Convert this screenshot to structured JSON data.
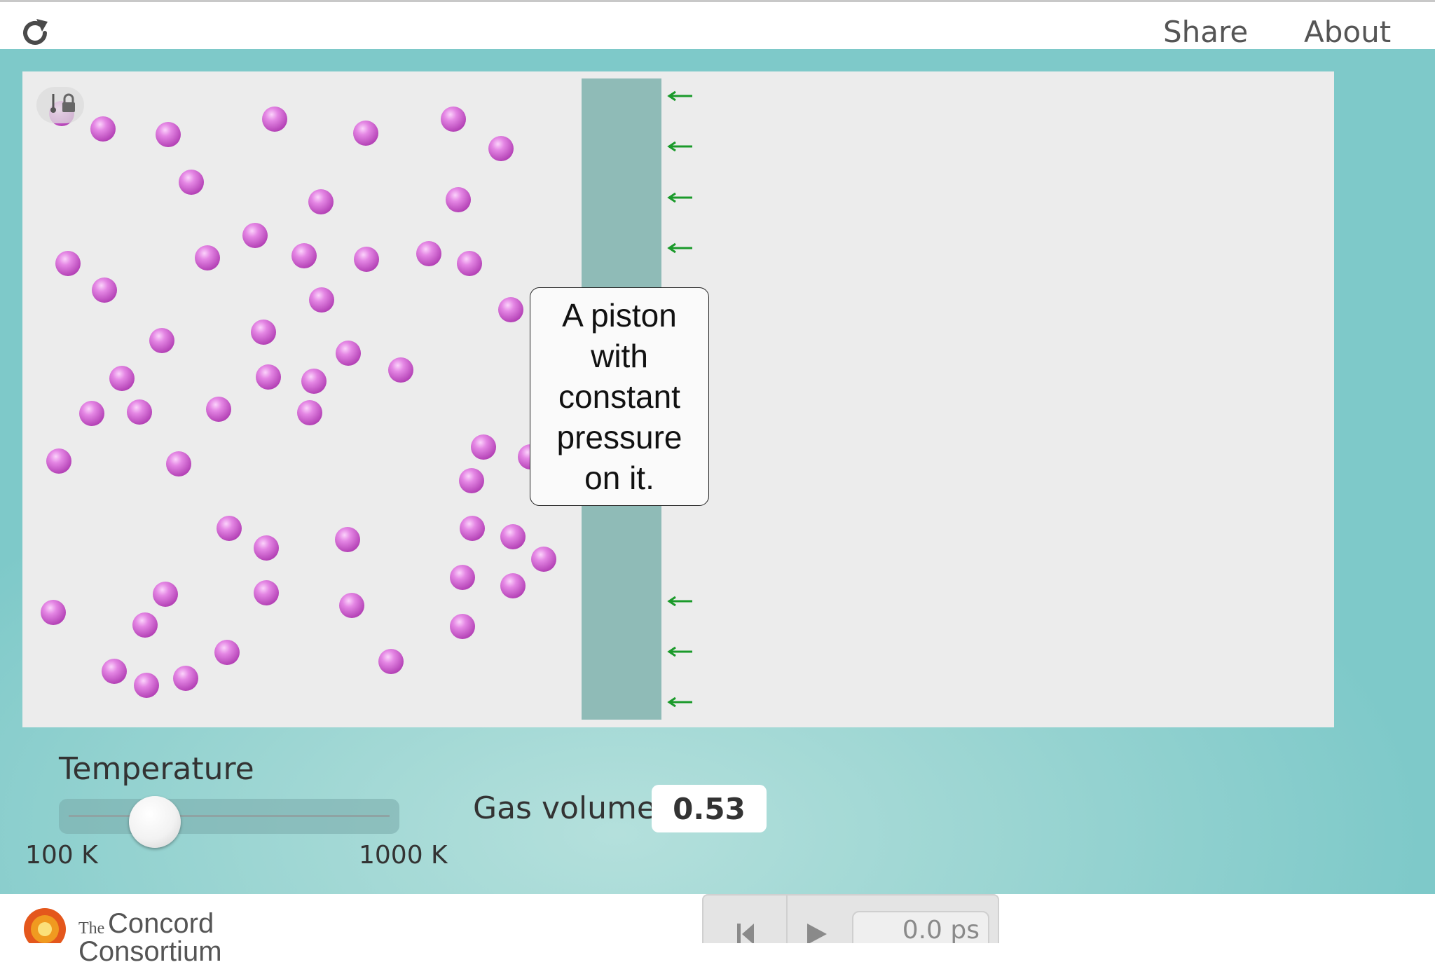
{
  "header": {
    "share_label": "Share",
    "about_label": "About"
  },
  "annotation": {
    "text": "A piston with constant pressure on it."
  },
  "controls": {
    "temperature_label": "Temperature",
    "temperature_min_label": "100 K",
    "temperature_max_label": "1000 K",
    "temperature_fraction": 0.24,
    "gas_volume_label": "Gas volume",
    "gas_volume_value": "0.53"
  },
  "footer": {
    "logo_small": "The",
    "logo_line1": "Concord",
    "logo_line2": "Consortium",
    "time_display": "0.0 ps"
  },
  "colors": {
    "molecule": "#d86ad8",
    "piston": "#8fbbb7",
    "pressure_arrow": "#1a9a2a",
    "background": "#9dd6d3"
  },
  "icons": [
    "reload-icon",
    "thermometer-icon",
    "lock-icon",
    "pressure-arrow-icon",
    "reset-icon",
    "play-icon",
    "logo-icon"
  ]
}
